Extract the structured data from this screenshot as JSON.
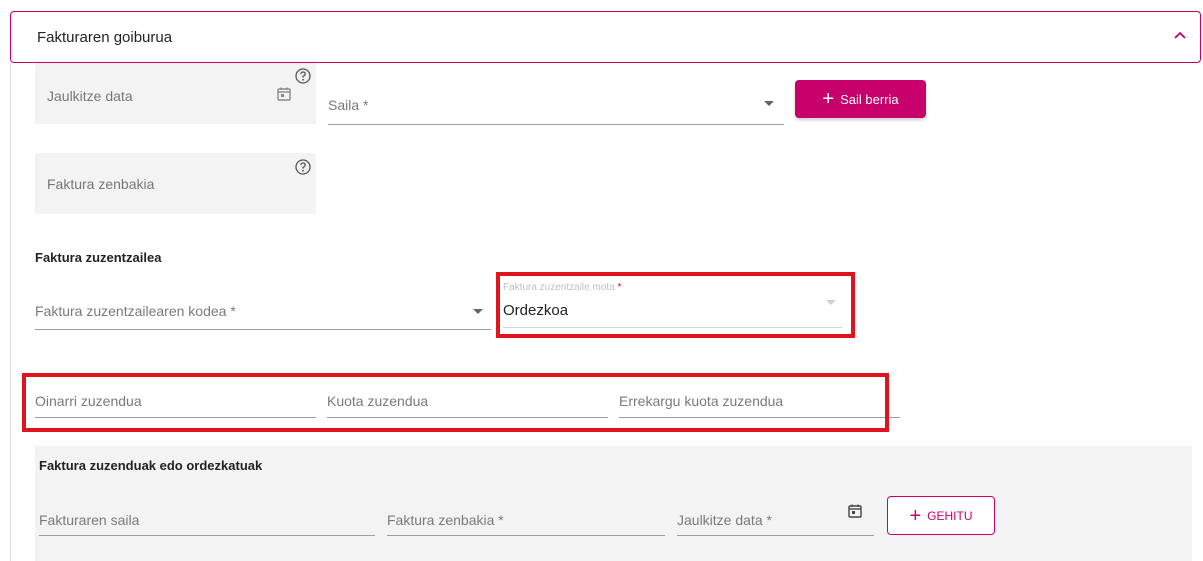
{
  "header": {
    "title": "Fakturaren goiburua",
    "chevron_icon": "chevron-up-icon"
  },
  "fields": {
    "jaulkitze_data": "Jaulkitze data",
    "saila": "Saila *",
    "faktura_zenbakia": "Faktura zenbakia"
  },
  "buttons": {
    "sail_berria": "Sail berria",
    "gehitu": "GEHITU"
  },
  "zuzentzailea": {
    "title": "Faktura zuzentzailea",
    "kodea": "Faktura zuzentzailearen kodea *",
    "mota_label": "Faktura zuzentzaile mota",
    "mota_required": "*",
    "mota_value": "Ordezkoa"
  },
  "zuzenduak": {
    "oinarri": "Oinarri zuzendua",
    "kuota": "Kuota zuzendua",
    "errekargu": "Errekargu kuota zuzendua"
  },
  "ordezkatuak": {
    "title": "Faktura zuzenduak edo ordezkatuak",
    "saila": "Fakturaren saila",
    "zenbakia": "Faktura zenbakia *",
    "data": "Jaulkitze data *"
  },
  "colors": {
    "accent": "#c8006b",
    "highlight": "#e0141e",
    "field_bg": "#f3f3f3"
  }
}
